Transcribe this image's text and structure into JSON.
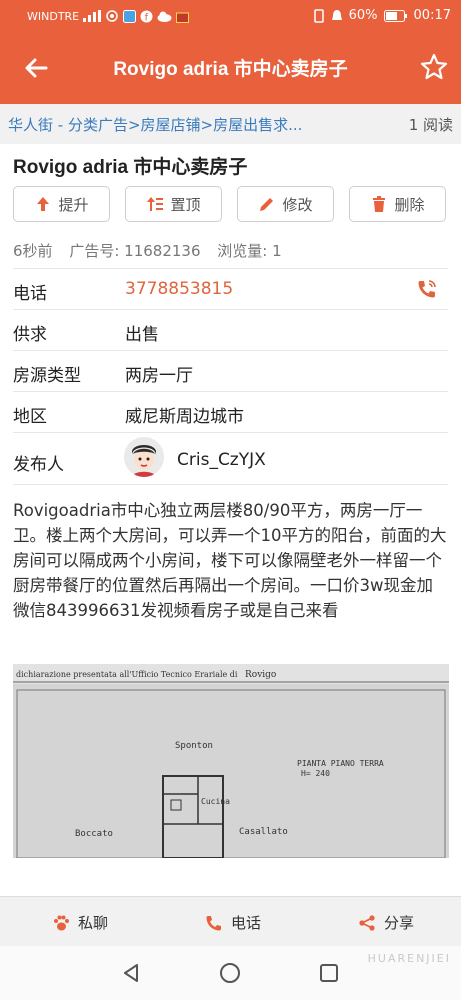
{
  "statusbar": {
    "carrier": "WINDTRE",
    "battery": "60%",
    "time": "00:17"
  },
  "appbar": {
    "title": "Rovigo adria 市中心卖房子"
  },
  "breadcrumb": {
    "path": "华人街 - 分类广告>房屋店铺>房屋出售求...",
    "reads": "1 阅读"
  },
  "post": {
    "title": "Rovigo adria 市中心卖房子",
    "actions": {
      "promote": "提升",
      "pin": "置顶",
      "edit": "修改",
      "delete": "删除"
    },
    "meta": {
      "time": "6秒前",
      "ad_id": "广告号: 11682136",
      "views": "浏览量: 1"
    },
    "details": {
      "phone_label": "电话",
      "phone_value": "3778853815",
      "supply_label": "供求",
      "supply_value": "出售",
      "type_label": "房源类型",
      "type_value": "两房一厅",
      "area_label": "地区",
      "area_value": "威尼斯周边城市",
      "publisher_label": "发布人",
      "publisher_value": "Cris_CzYJX"
    },
    "description": "Rovigoadria市中心独立两层楼80/90平方，两房一厅一卫。楼上两个大房间，可以弄一个10平方的阳台，前面的大房间可以隔成两个小房间，楼下可以像隔壁老外一样留一个厨房带餐厅的位置然后再隔出一个房间。一口价3w现金加微信843996631发视频看房子或是自己来看",
    "floorplan": {
      "header": "dichiarazione presentata all'Ufficio Tecnico Erariale di",
      "city": "Rovigo",
      "spanton": "Sponton",
      "plan_title": "PIANTA PIANO TERRA",
      "height": "H= 240",
      "cucina": "Cucina",
      "boccato": "Boccato",
      "casallato": "Casallato"
    }
  },
  "bottom": {
    "chat": "私聊",
    "call": "电话",
    "share": "分享"
  },
  "watermark": "HUARENJIEI",
  "colors": {
    "accent": "#e8603c",
    "link": "#3a7bbf",
    "phone": "#e0643d"
  }
}
